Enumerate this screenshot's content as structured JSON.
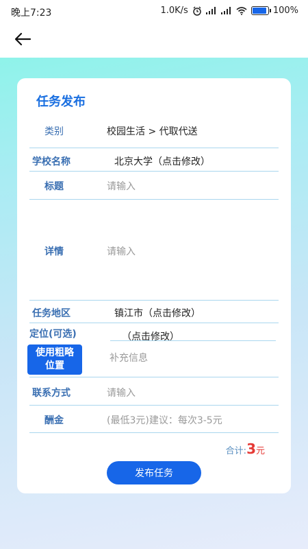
{
  "status_bar": {
    "time": "晚上7:23",
    "network_speed": "1.0K/s",
    "signal1": "HD",
    "signal2": "HD",
    "battery": "100%",
    "battery_level": 1.0
  },
  "form": {
    "title": "任务发布",
    "category": {
      "label": "类别",
      "value": "校园生活 > 代取代送"
    },
    "school": {
      "label": "学校名称",
      "value": "北京大学（点击修改）"
    },
    "subject": {
      "label": "标题",
      "placeholder": "请输入"
    },
    "details": {
      "label": "详情",
      "placeholder": "请输入"
    },
    "region": {
      "label": "任务地区",
      "value": "镇江市（点击修改）"
    },
    "location": {
      "label": "定位(可选)",
      "value": "（点击修改）"
    },
    "rough_location_button": "使用粗略\n位置",
    "extra_info": {
      "placeholder": "补充信息"
    },
    "contact": {
      "label": "联系方式",
      "placeholder": "请输入"
    },
    "reward": {
      "label": "酬金",
      "placeholder": "(最低3元)建议：每次3-5元"
    },
    "total": {
      "label": "合计:",
      "amount": "3",
      "unit": "元"
    },
    "publish_button": "发布任务"
  }
}
